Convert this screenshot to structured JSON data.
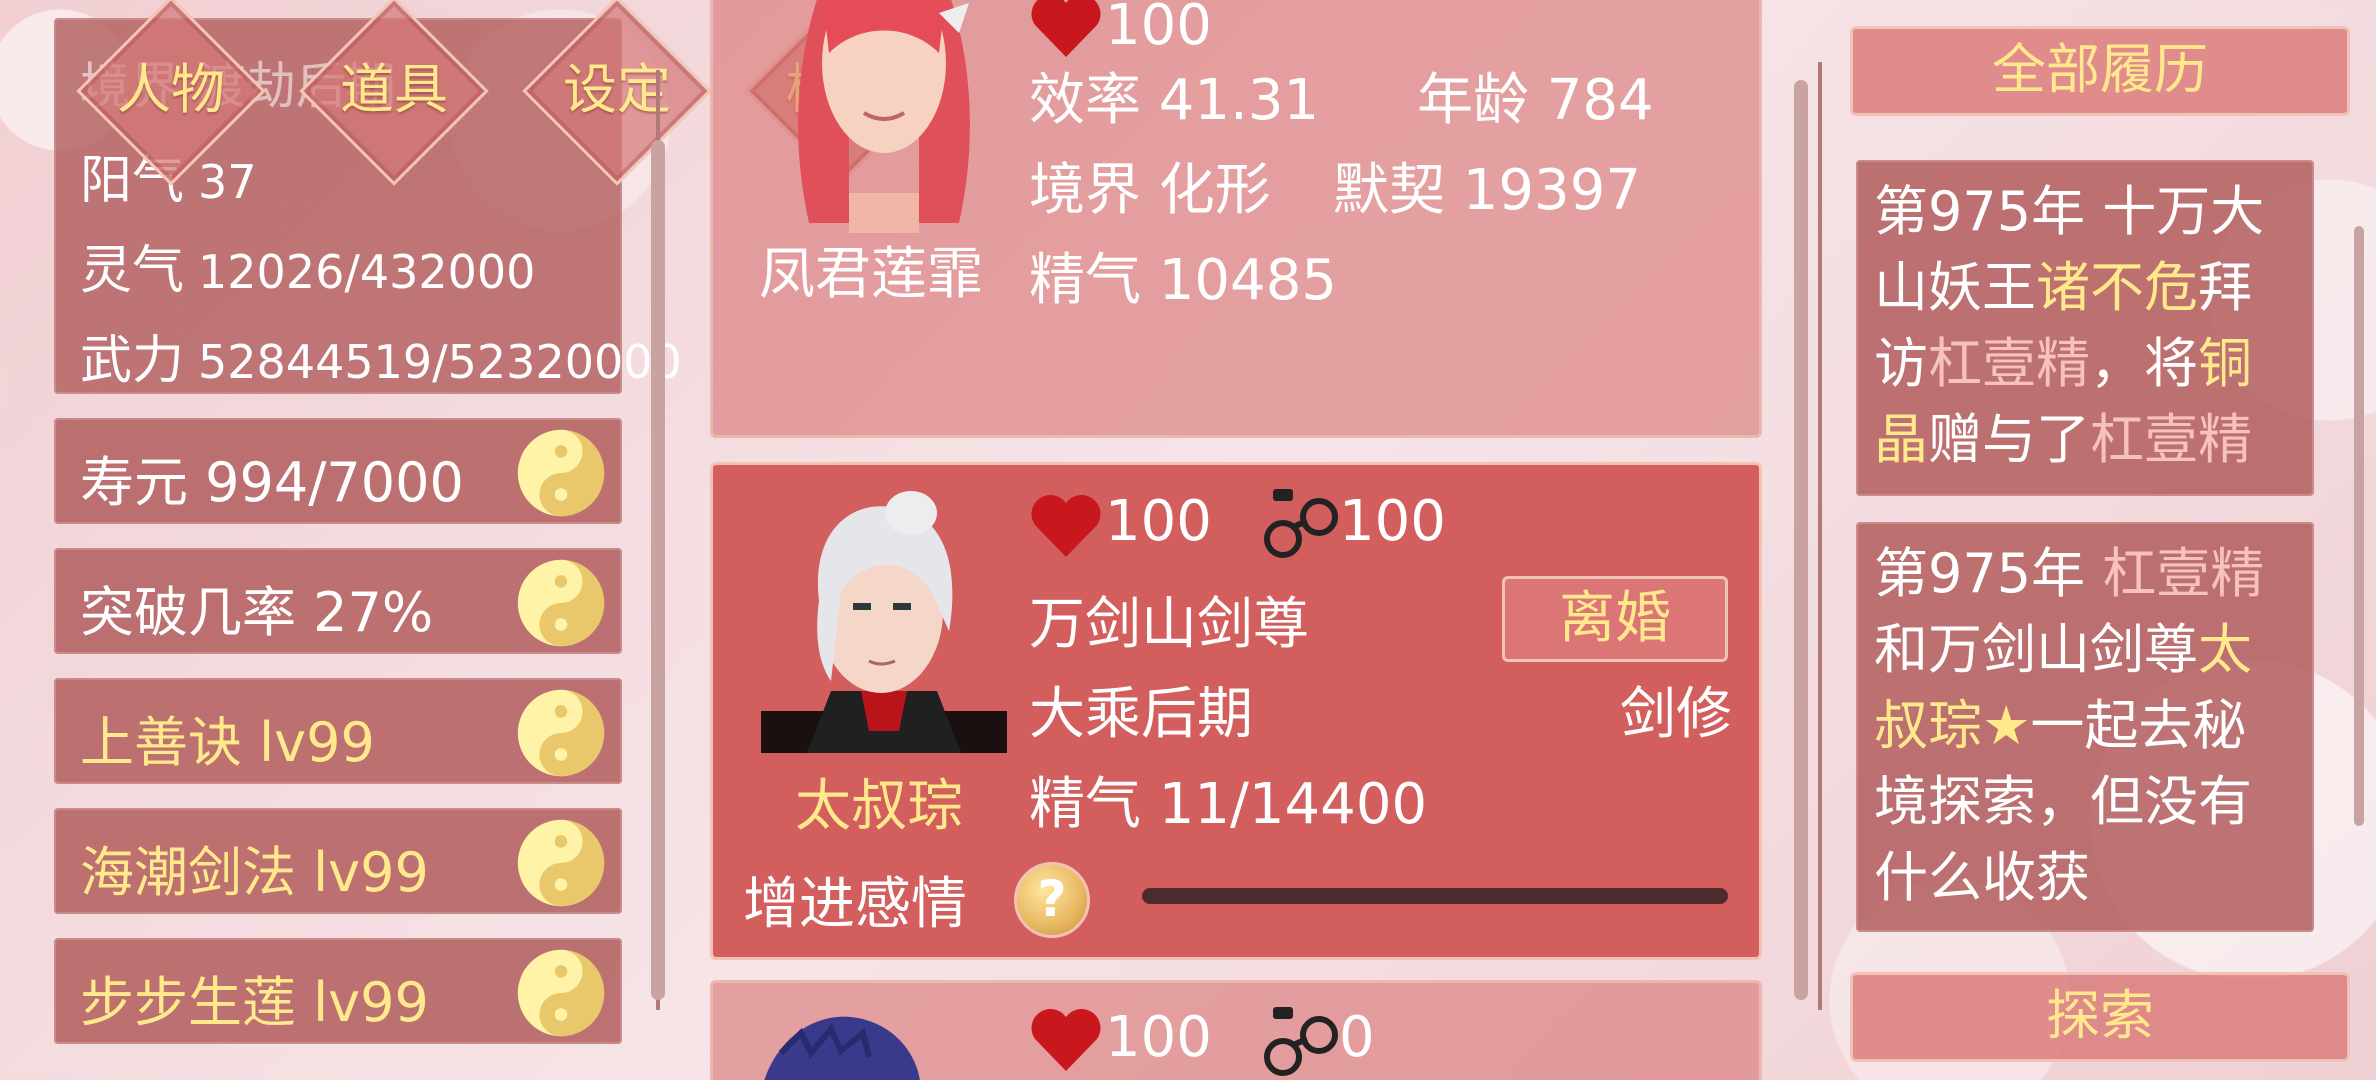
{
  "nav": [
    "人物",
    "道具",
    "设定",
    "榜单"
  ],
  "stats": {
    "realm_line": "境界 渡劫后期",
    "yang_label": "阳气",
    "yang_value": "37",
    "qi_label": "灵气",
    "qi_value": "12026/432000",
    "power_label": "武力",
    "power_value": "52844519/52320000"
  },
  "skills": [
    {
      "label": "寿元 994/7000",
      "gold": false
    },
    {
      "label": "突破几率 27%",
      "gold": false
    },
    {
      "label": "上善诀 lv99",
      "gold": true
    },
    {
      "label": "海潮剑法 lv99",
      "gold": true
    },
    {
      "label": "步步生莲 lv99",
      "gold": true
    }
  ],
  "cards": [
    {
      "name": "凤君莲霏",
      "heart": "100",
      "efficiency": "效率 41.31",
      "age": "年龄 784",
      "realm": "境界 化形",
      "tacit": "默契 19397",
      "essence": "精气 10485"
    },
    {
      "name": "太叔琮",
      "heart": "100",
      "bond": "100",
      "title": "万剑山剑尊",
      "realm": "大乘后期",
      "essence": "精气 11/14400",
      "divorce": "离婚",
      "class": "剑修",
      "affection_label": "增进感情",
      "help": "?",
      "affection_progress": 0.0
    },
    {
      "heart": "100",
      "bond": "0"
    }
  ],
  "right": {
    "history_button": "全部履历",
    "explore_button": "探索",
    "log1": {
      "p1": "第975年 十万大山妖王",
      "n1": "诸不危",
      "p2": "拜访",
      "n2": "杠壹精",
      "p3": "，将",
      "n3": "铜晶",
      "p4": "赠与了",
      "n4": "杠壹精"
    },
    "log2": {
      "p1": "第975年 ",
      "n1": "杠壹精",
      "p2": "和万剑山剑尊",
      "n2": "太叔琮★",
      "p3": "一起去秘境探索，但没有什么收获"
    }
  },
  "colors": {
    "accent_gold": "#ffe98c",
    "accent_pink": "#f7c2be",
    "panel": "#b05858",
    "active_card": "#d35e5e"
  }
}
